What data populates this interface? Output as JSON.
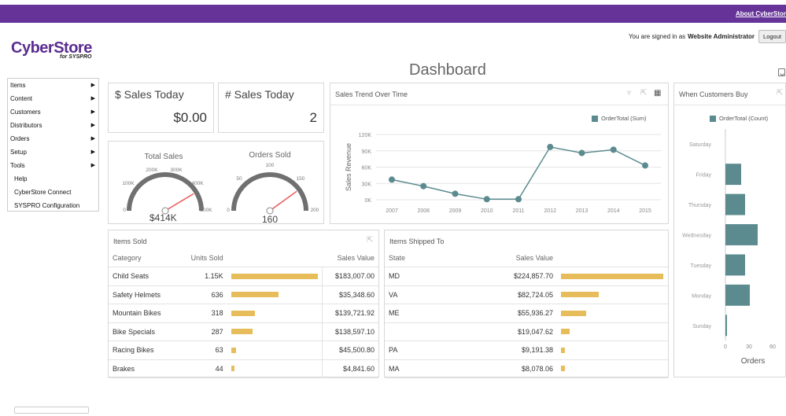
{
  "header": {
    "about_link": "About CyberStor",
    "signed_in_prefix": "You are signed in as",
    "user_name": "Website Administrator",
    "logout_label": "Logout"
  },
  "logo": {
    "name": "CyberStore",
    "sub": "for SYSPRO"
  },
  "page": {
    "title": "Dashboard"
  },
  "menu": {
    "items": [
      {
        "label": "Items",
        "has_submenu": true
      },
      {
        "label": "Content",
        "has_submenu": true
      },
      {
        "label": "Customers",
        "has_submenu": true
      },
      {
        "label": "Distributors",
        "has_submenu": true
      },
      {
        "label": "Orders",
        "has_submenu": true
      },
      {
        "label": "Setup",
        "has_submenu": true
      },
      {
        "label": "Tools",
        "has_submenu": true
      },
      {
        "label": "Help",
        "has_submenu": false
      },
      {
        "label": "CyberStore Connect",
        "has_submenu": false
      },
      {
        "label": "SYSPRO Configuration",
        "has_submenu": false
      }
    ]
  },
  "cards": {
    "sales_today": {
      "title": "$ Sales Today",
      "value": "$0.00"
    },
    "count_today": {
      "title": "# Sales Today",
      "value": "2"
    }
  },
  "gauges": {
    "total_sales": {
      "title": "Total Sales",
      "value_label": "$414K",
      "value": 414,
      "min": 0,
      "max": 500,
      "ticks": [
        "0",
        "100K",
        "200K",
        "300K",
        "400K",
        "500K"
      ]
    },
    "orders_sold": {
      "title": "Orders Sold",
      "value_label": "160",
      "value": 160,
      "min": 0,
      "max": 200,
      "ticks": [
        "0",
        "50",
        "100",
        "150",
        "200"
      ]
    }
  },
  "chart_data": [
    {
      "type": "line",
      "title": "Sales Trend Over Time",
      "ylabel": "Sales Revenue",
      "legend": "OrderTotal (Sum)",
      "legend_position": "top-right",
      "x": [
        "2007",
        "2008",
        "2009",
        "2010",
        "2011",
        "2012",
        "2013",
        "2014",
        "2015"
      ],
      "values": [
        37000,
        25000,
        11000,
        1000,
        1000,
        97000,
        86000,
        92000,
        63000
      ],
      "ylim": [
        0,
        120000
      ],
      "yticks": [
        "0K",
        "30K",
        "60K",
        "90K",
        "120K"
      ],
      "grid": true,
      "color": "#5b8a8f"
    },
    {
      "type": "bar",
      "orientation": "horizontal",
      "title": "When Customers Buy",
      "legend": "OrderTotal (Count)",
      "xlabel": "Orders",
      "categories": [
        "Saturday",
        "Friday",
        "Thursday",
        "Wednesday",
        "Tuesday",
        "Monday",
        "Sunday"
      ],
      "values": [
        0,
        20,
        25,
        41,
        25,
        31,
        2
      ],
      "xlim": [
        0,
        70
      ],
      "xticks": [
        "0",
        "30",
        "60"
      ],
      "color": "#5b8a8f"
    }
  ],
  "items_sold": {
    "title": "Items Sold",
    "headers": [
      "Category",
      "Units Sold",
      "",
      "Sales Value"
    ],
    "max_units": 1150,
    "rows": [
      {
        "category": "Child Seats",
        "units": "1.15K",
        "units_num": 1150,
        "value": "$183,007.00"
      },
      {
        "category": "Safety Helmets",
        "units": "636",
        "units_num": 636,
        "value": "$35,348.60"
      },
      {
        "category": "Mountain Bikes",
        "units": "318",
        "units_num": 318,
        "value": "$139,721.92"
      },
      {
        "category": "Bike Specials",
        "units": "287",
        "units_num": 287,
        "value": "$138,597.10"
      },
      {
        "category": "Racing Bikes",
        "units": "63",
        "units_num": 63,
        "value": "$45,500.80"
      },
      {
        "category": "Brakes",
        "units": "44",
        "units_num": 44,
        "value": "$4,841.60"
      }
    ]
  },
  "items_shipped": {
    "title": "Items Shipped To",
    "headers": [
      "State",
      "Sales Value",
      ""
    ],
    "max_value": 224857.7,
    "rows": [
      {
        "state": "MD",
        "value": "$224,857.70",
        "value_num": 224857.7
      },
      {
        "state": "VA",
        "value": "$82,724.05",
        "value_num": 82724.05
      },
      {
        "state": "ME",
        "value": "$55,936.27",
        "value_num": 55936.27
      },
      {
        "state": "",
        "value": "$19,047.62",
        "value_num": 19047.62
      },
      {
        "state": "PA",
        "value": "$9,191.38",
        "value_num": 9191.38
      },
      {
        "state": "MA",
        "value": "$8,078.06",
        "value_num": 8078.06
      }
    ]
  },
  "colors": {
    "brand": "#663399",
    "series": "#5b8a8f",
    "bar": "#e6bd5a",
    "needle": "#e55"
  }
}
